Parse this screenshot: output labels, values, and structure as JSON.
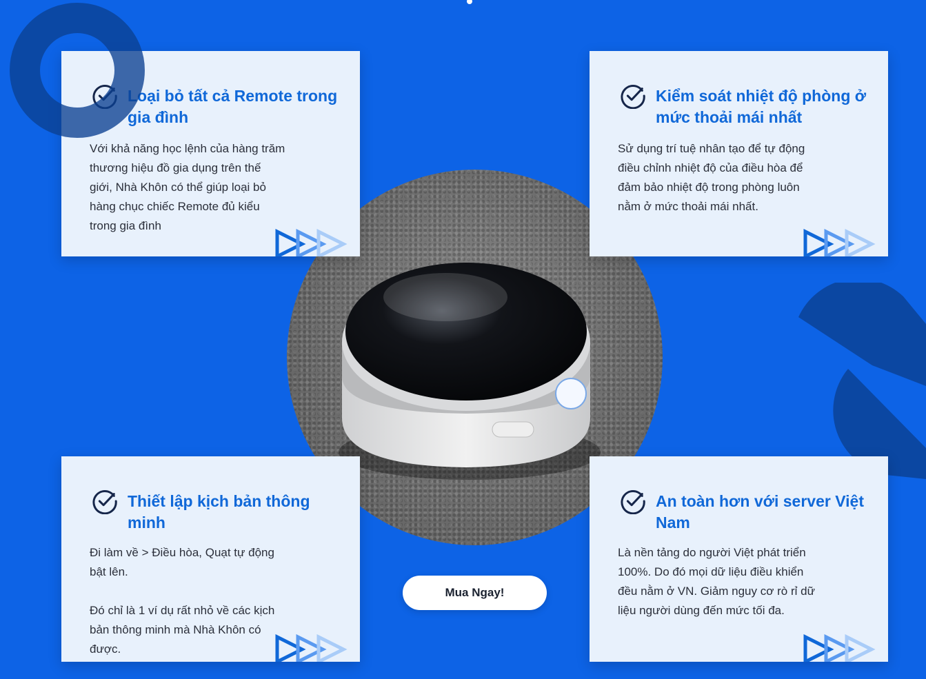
{
  "cards": [
    {
      "title": "Loại bỏ tất cả Remote trong gia đình",
      "body": "Với khả năng học lệnh của hàng trăm\nthương hiệu đồ gia dụng trên thế\ngiới, Nhà Khôn có thể giúp loại bỏ\nhàng chục chiếc Remote đủ kiểu\ntrong gia đình"
    },
    {
      "title": "Kiểm soát nhiệt độ phòng ở mức thoải mái nhất",
      "body": "Sử dụng trí tuệ nhân tạo để tự động\nđiều chỉnh nhiệt độ của điều hòa để\nđảm bảo nhiệt độ trong phòng luôn\nnằm ở mức thoải mái nhất."
    },
    {
      "title": "Thiết lập kịch bản thông minh",
      "body": "Đi làm về > Điều hòa, Quạt tự động\nbật lên.\n\nĐó chỉ là 1 ví dụ rất nhỏ về các kịch\nbản thông minh mà Nhà Khôn có\nđược."
    },
    {
      "title": "An toàn hơn với server Việt Nam",
      "body": "Là nền tảng do người Việt phát triển\n100%. Do đó mọi dữ liệu điều khiển\nđều nằm ở VN. Giảm nguy cơ rò rỉ dữ\nliệu người dùng đến mức tối đa."
    }
  ],
  "cta": {
    "label": "Mua Ngay!"
  },
  "icons": {
    "check": "check-circle-icon",
    "arrows": "triple-chevron-icon"
  },
  "colors": {
    "background": "#0d63e6",
    "card": "#e8f1fc",
    "title": "#1068d8",
    "text": "#2b2f3a"
  }
}
